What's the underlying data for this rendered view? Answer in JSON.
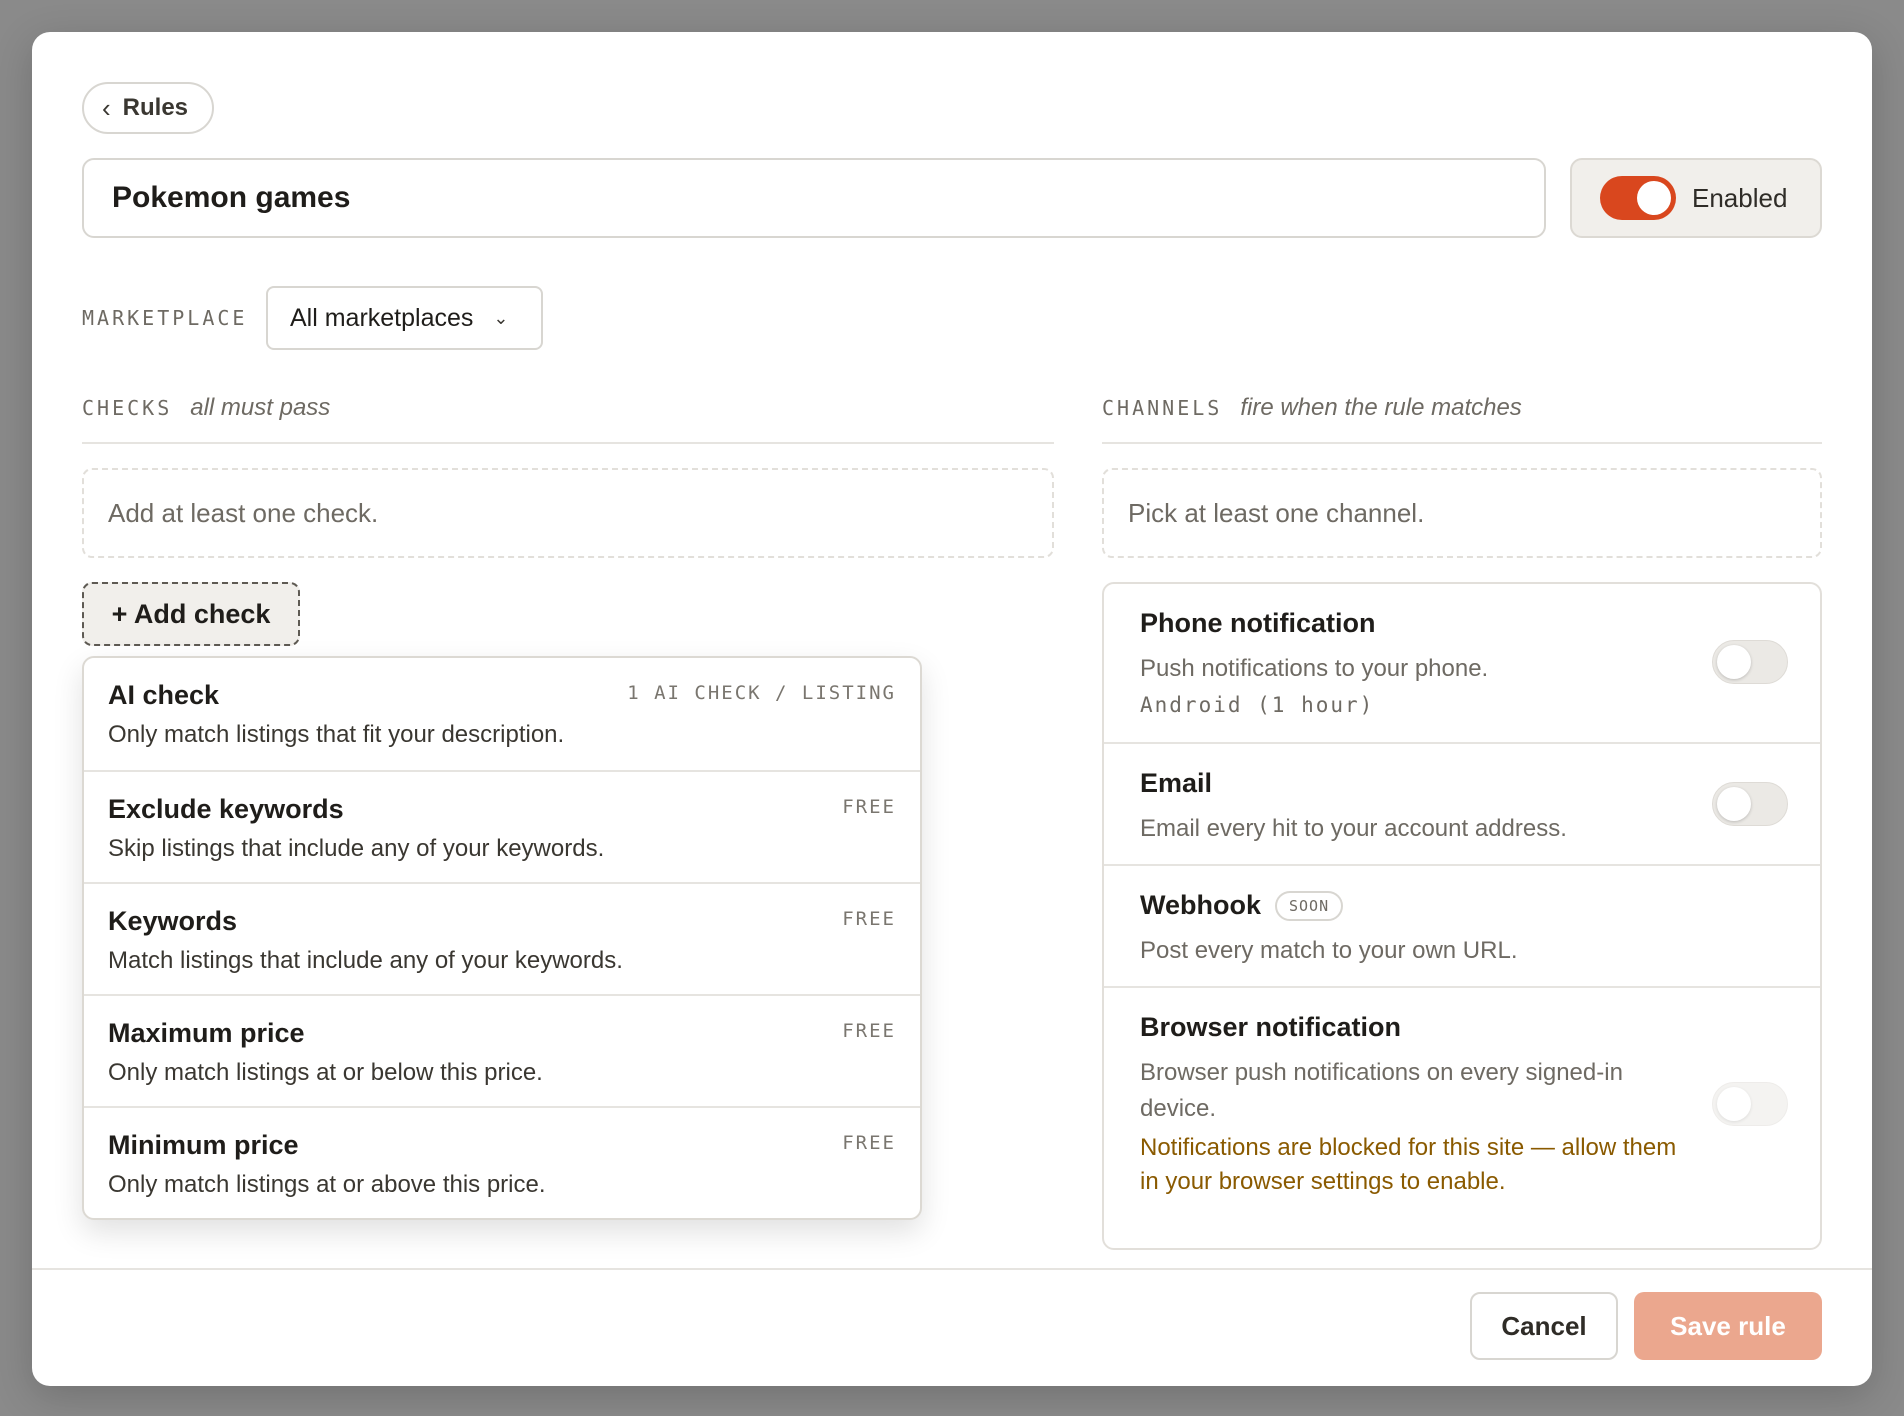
{
  "back": {
    "label": "Rules",
    "icon": "chevron-left-icon"
  },
  "rule": {
    "name": "Pokemon games",
    "enabled_label": "Enabled",
    "enabled": true
  },
  "marketplace": {
    "label": "MARKETPLACE",
    "selected": "All marketplaces"
  },
  "checks": {
    "label": "CHECKS",
    "hint": "all must pass",
    "empty": "Add at least one check.",
    "add_label": "+ Add check",
    "options": [
      {
        "title": "AI check",
        "desc": "Only match listings that fit your description.",
        "tag": "1 AI CHECK / LISTING"
      },
      {
        "title": "Exclude keywords",
        "desc": "Skip listings that include any of your keywords.",
        "tag": "FREE"
      },
      {
        "title": "Keywords",
        "desc": "Match listings that include any of your keywords.",
        "tag": "FREE"
      },
      {
        "title": "Maximum price",
        "desc": "Only match listings at or below this price.",
        "tag": "FREE"
      },
      {
        "title": "Minimum price",
        "desc": "Only match listings at or above this price.",
        "tag": "FREE"
      }
    ]
  },
  "channels": {
    "label": "CHANNELS",
    "hint": "fire when the rule matches",
    "empty": "Pick at least one channel.",
    "items": [
      {
        "title": "Phone notification",
        "desc": "Push notifications to your phone.",
        "detail": "Android (1 hour)",
        "enabled": false
      },
      {
        "title": "Email",
        "desc": "Email every hit to your account address.",
        "enabled": false
      },
      {
        "title": "Webhook",
        "badge": "SOON",
        "desc": "Post every match to your own URL."
      },
      {
        "title": "Browser notification",
        "desc": "Browser push notifications on every signed-in device.",
        "warning": "Notifications are blocked for this site — allow them in your browser settings to enable.",
        "enabled": false
      }
    ]
  },
  "footer": {
    "cancel": "Cancel",
    "save": "Save rule"
  },
  "colors": {
    "accent": "#d9471e",
    "save_disabled": "#eba78e",
    "warning": "#8a5a00"
  }
}
